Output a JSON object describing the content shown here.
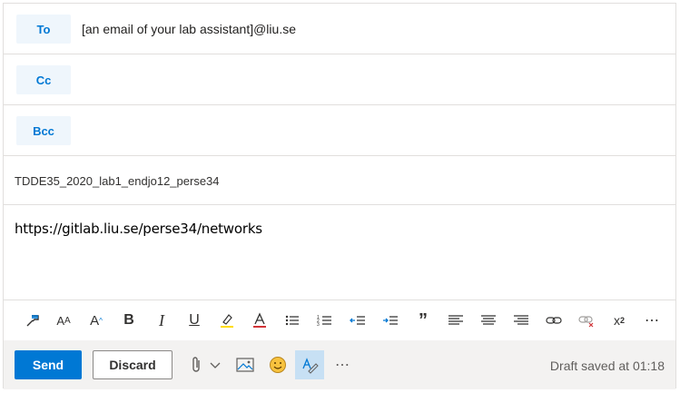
{
  "recipients": {
    "to_label": "To",
    "to_value": "[an email of your lab assistant]@liu.se",
    "cc_label": "Cc",
    "bcc_label": "Bcc"
  },
  "subject": "TDDE35_2020_lab1_endjo12_perse34",
  "body": "https://gitlab.liu.se/perse34/networks",
  "format_toolbar": [
    "format-painter-icon",
    "font-size-icon",
    "grow-font-icon",
    "bold-icon",
    "italic-icon",
    "underline-icon",
    "highlight-icon",
    "font-color-icon",
    "bullets-icon",
    "numbering-icon",
    "decrease-indent-icon",
    "increase-indent-icon",
    "quote-icon",
    "align-left-icon",
    "align-center-icon",
    "align-right-icon",
    "insert-link-icon",
    "remove-link-icon",
    "superscript-icon",
    "more-formatting-icon"
  ],
  "actions": {
    "send_label": "Send",
    "discard_label": "Discard"
  },
  "bottom_icons": [
    "attach-icon",
    "chevron-down-icon",
    "image-icon",
    "emoji-icon",
    "editor-icon",
    "more-options-icon"
  ],
  "status": "Draft saved at 01:18",
  "colors": {
    "accent": "#0078d4",
    "recipient_button_bg": "#eff6fc",
    "bottom_bar_bg": "#f3f2f1",
    "editor_highlight": "#c7e0f4",
    "emoji_yellow": "#f7c23e"
  }
}
